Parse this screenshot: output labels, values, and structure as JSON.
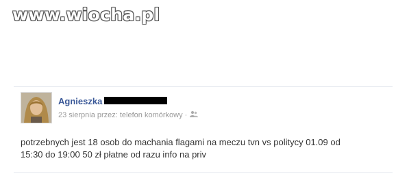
{
  "watermark": {
    "text": "www.wiocha.pl"
  },
  "post": {
    "author": "Agnieszka",
    "meta": "23 sierpnia przez: telefon komórkowy ·",
    "privacy_icon": "friends-icon",
    "text_line_1": "potrzebnych jest 18 osob do machania flagami na meczu tvn vs politycy 01.09 od",
    "text_line_2": "15:30 do 19:00 50 zł płatne od razu info na priv"
  },
  "colors": {
    "author": "#3b5998",
    "meta": "#999999",
    "text": "#333333",
    "divider": "#e3e6ee"
  }
}
